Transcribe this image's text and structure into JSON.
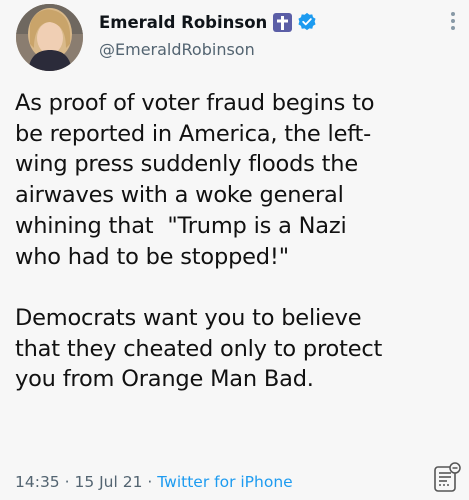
{
  "user": {
    "display_name": "Emerald Robinson",
    "handle": "@EmeraldRobinson",
    "badges": [
      "cross-icon",
      "verified-badge-icon"
    ]
  },
  "tweet": {
    "lines": [
      "As proof of voter fraud begins to",
      "be reported in America, the left-",
      "wing press suddenly floods the",
      "airwaves with a woke general",
      "whining that  \"Trump is a Nazi",
      "who had to be stopped!\"",
      "",
      "Democrats want you to believe",
      "that they cheated only to protect",
      "you from Orange Man Bad."
    ]
  },
  "meta": {
    "time": "14:35",
    "separator": " · ",
    "date": "15 Jul 21",
    "source": "Twitter for iPhone"
  },
  "colors": {
    "verified": "#1d9bf0",
    "cross_badge": "#5b5ea6",
    "secondary_text": "#536471",
    "link": "#1d9bf0"
  }
}
